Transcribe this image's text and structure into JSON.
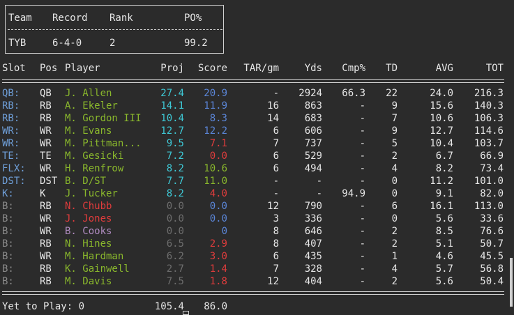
{
  "team_summary": {
    "headers": [
      "Team",
      "Record",
      "Rank",
      "PO%"
    ],
    "values": [
      "TYB",
      "6-4-0",
      "2",
      "99.2"
    ]
  },
  "columns": [
    "Slot",
    "Pos",
    "Player",
    "Proj",
    "Score",
    "TAR/gm",
    "Yds",
    "Cmp%",
    "TD",
    "AVG",
    "TOT"
  ],
  "colors": {
    "slot_starter": "#6f9fd8",
    "slot_bench": "#8a8a8a",
    "player_green": "#8ab82c",
    "player_red": "#e03c3c",
    "player_purple": "#b08cc0",
    "proj_cyan": "#3ec9d6",
    "proj_gray": "#6e6e6e",
    "score_cyan": "#3ec9d6",
    "score_blue": "#5b86d8",
    "score_green": "#8ab82c",
    "score_red": "#e03c3c",
    "text": "#e6e6e6"
  },
  "rows": [
    {
      "slot": "QB:",
      "pos": "QB",
      "player": "J. Allen",
      "proj": "27.4",
      "score": "20.9",
      "tar": "-",
      "yds": "2924",
      "cmp": "66.3",
      "td": "22",
      "avg": "24.0",
      "tot": "216.3",
      "slot_c": "slot_starter",
      "player_c": "player_green",
      "proj_c": "proj_cyan",
      "score_c": "score_blue"
    },
    {
      "slot": "RB:",
      "pos": "RB",
      "player": "A. Ekeler",
      "proj": "14.1",
      "score": "11.9",
      "tar": "16",
      "yds": "863",
      "cmp": "-",
      "td": "9",
      "avg": "15.6",
      "tot": "140.3",
      "slot_c": "slot_starter",
      "player_c": "player_green",
      "proj_c": "proj_cyan",
      "score_c": "score_blue"
    },
    {
      "slot": "RB:",
      "pos": "RB",
      "player": "M. Gordon III",
      "proj": "10.4",
      "score": "8.3",
      "tar": "14",
      "yds": "683",
      "cmp": "-",
      "td": "7",
      "avg": "10.6",
      "tot": "106.3",
      "slot_c": "slot_starter",
      "player_c": "player_green",
      "proj_c": "proj_cyan",
      "score_c": "score_blue"
    },
    {
      "slot": "WR:",
      "pos": "WR",
      "player": "M. Evans",
      "proj": "12.7",
      "score": "12.2",
      "tar": "6",
      "yds": "606",
      "cmp": "-",
      "td": "9",
      "avg": "12.7",
      "tot": "114.6",
      "slot_c": "slot_starter",
      "player_c": "player_green",
      "proj_c": "proj_cyan",
      "score_c": "score_blue"
    },
    {
      "slot": "WR:",
      "pos": "WR",
      "player": "M. Pittman...",
      "proj": "9.5",
      "score": "7.1",
      "tar": "7",
      "yds": "737",
      "cmp": "-",
      "td": "5",
      "avg": "10.4",
      "tot": "103.7",
      "slot_c": "slot_starter",
      "player_c": "player_green",
      "proj_c": "proj_cyan",
      "score_c": "score_red"
    },
    {
      "slot": "TE:",
      "pos": "TE",
      "player": "M. Gesicki",
      "proj": "7.2",
      "score": "0.0",
      "tar": "6",
      "yds": "529",
      "cmp": "-",
      "td": "2",
      "avg": "6.7",
      "tot": "66.9",
      "slot_c": "slot_starter",
      "player_c": "player_green",
      "proj_c": "proj_cyan",
      "score_c": "score_red"
    },
    {
      "slot": "FLX:",
      "pos": "WR",
      "player": "H. Renfrow",
      "proj": "8.2",
      "score": "10.6",
      "tar": "6",
      "yds": "494",
      "cmp": "-",
      "td": "4",
      "avg": "8.2",
      "tot": "73.4",
      "slot_c": "slot_starter",
      "player_c": "player_green",
      "proj_c": "proj_cyan",
      "score_c": "score_green"
    },
    {
      "slot": "DST:",
      "pos": "DST",
      "player": "B. D/ST",
      "proj": "7.7",
      "score": "11.0",
      "tar": "-",
      "yds": "-",
      "cmp": "-",
      "td": "0",
      "avg": "11.2",
      "tot": "101.0",
      "slot_c": "slot_starter",
      "player_c": "player_green",
      "proj_c": "proj_cyan",
      "score_c": "score_green"
    },
    {
      "slot": "K:",
      "pos": "K",
      "player": "J. Tucker",
      "proj": "8.2",
      "score": "4.0",
      "tar": "-",
      "yds": "-",
      "cmp": "94.9",
      "td": "0",
      "avg": "9.1",
      "tot": "82.0",
      "slot_c": "slot_starter",
      "player_c": "player_green",
      "proj_c": "proj_cyan",
      "score_c": "score_red"
    },
    {
      "slot": "B:",
      "pos": "RB",
      "player": "N. Chubb",
      "proj": "0.0",
      "score": "0.0",
      "tar": "12",
      "yds": "790",
      "cmp": "-",
      "td": "6",
      "avg": "16.1",
      "tot": "113.0",
      "slot_c": "slot_bench",
      "player_c": "player_red",
      "proj_c": "proj_gray",
      "score_c": "score_blue"
    },
    {
      "slot": "B:",
      "pos": "WR",
      "player": "J. Jones",
      "proj": "0.0",
      "score": "0.0",
      "tar": "3",
      "yds": "336",
      "cmp": "-",
      "td": "0",
      "avg": "5.6",
      "tot": "33.6",
      "slot_c": "slot_bench",
      "player_c": "player_red",
      "proj_c": "proj_gray",
      "score_c": "score_blue"
    },
    {
      "slot": "B:",
      "pos": "WR",
      "player": "B. Cooks",
      "proj": "0.0",
      "score": "0",
      "tar": "8",
      "yds": "646",
      "cmp": "-",
      "td": "2",
      "avg": "8.5",
      "tot": "76.6",
      "slot_c": "slot_bench",
      "player_c": "player_purple",
      "proj_c": "proj_gray",
      "score_c": "score_blue"
    },
    {
      "slot": "B:",
      "pos": "RB",
      "player": "N. Hines",
      "proj": "6.5",
      "score": "2.9",
      "tar": "8",
      "yds": "407",
      "cmp": "-",
      "td": "2",
      "avg": "5.1",
      "tot": "50.7",
      "slot_c": "slot_bench",
      "player_c": "player_green",
      "proj_c": "proj_gray",
      "score_c": "score_red"
    },
    {
      "slot": "B:",
      "pos": "WR",
      "player": "M. Hardman",
      "proj": "6.2",
      "score": "3.0",
      "tar": "6",
      "yds": "435",
      "cmp": "-",
      "td": "1",
      "avg": "4.6",
      "tot": "45.5",
      "slot_c": "slot_bench",
      "player_c": "player_green",
      "proj_c": "proj_gray",
      "score_c": "score_red"
    },
    {
      "slot": "B:",
      "pos": "RB",
      "player": "K. Gainwell",
      "proj": "2.7",
      "score": "1.4",
      "tar": "7",
      "yds": "328",
      "cmp": "-",
      "td": "4",
      "avg": "5.7",
      "tot": "56.8",
      "slot_c": "slot_bench",
      "player_c": "player_green",
      "proj_c": "proj_gray",
      "score_c": "score_red"
    },
    {
      "slot": "B:",
      "pos": "RB",
      "player": "M. Davis",
      "proj": "7.5",
      "score": "1.8",
      "tar": "12",
      "yds": "404",
      "cmp": "-",
      "td": "2",
      "avg": "5.6",
      "tot": "50.4",
      "slot_c": "slot_bench",
      "player_c": "player_green",
      "proj_c": "proj_gray",
      "score_c": "score_red"
    }
  ],
  "footer": {
    "label": "Yet to Play: 0",
    "proj_total": "105.4",
    "score_total": "86.0"
  }
}
